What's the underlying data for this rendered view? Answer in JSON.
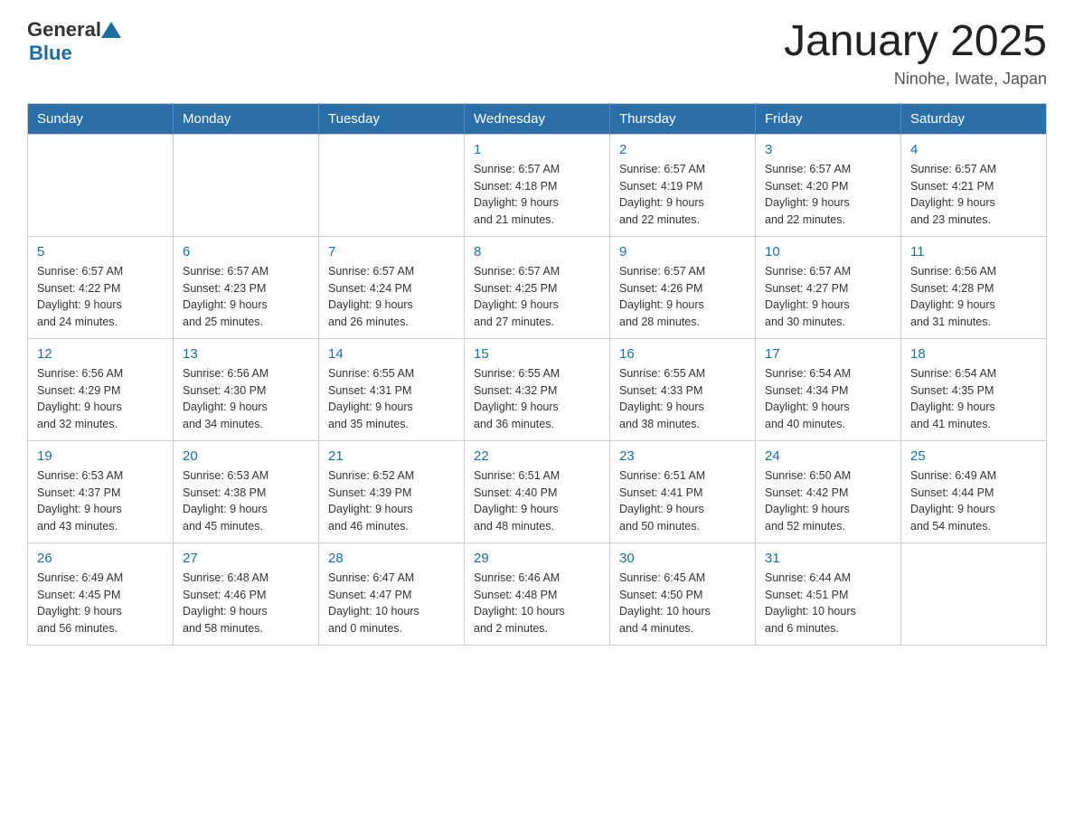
{
  "header": {
    "logo_general": "General",
    "logo_blue": "Blue",
    "title": "January 2025",
    "subtitle": "Ninohe, Iwate, Japan"
  },
  "weekdays": [
    "Sunday",
    "Monday",
    "Tuesday",
    "Wednesday",
    "Thursday",
    "Friday",
    "Saturday"
  ],
  "weeks": [
    [
      {
        "day": "",
        "info": ""
      },
      {
        "day": "",
        "info": ""
      },
      {
        "day": "",
        "info": ""
      },
      {
        "day": "1",
        "info": "Sunrise: 6:57 AM\nSunset: 4:18 PM\nDaylight: 9 hours\nand 21 minutes."
      },
      {
        "day": "2",
        "info": "Sunrise: 6:57 AM\nSunset: 4:19 PM\nDaylight: 9 hours\nand 22 minutes."
      },
      {
        "day": "3",
        "info": "Sunrise: 6:57 AM\nSunset: 4:20 PM\nDaylight: 9 hours\nand 22 minutes."
      },
      {
        "day": "4",
        "info": "Sunrise: 6:57 AM\nSunset: 4:21 PM\nDaylight: 9 hours\nand 23 minutes."
      }
    ],
    [
      {
        "day": "5",
        "info": "Sunrise: 6:57 AM\nSunset: 4:22 PM\nDaylight: 9 hours\nand 24 minutes."
      },
      {
        "day": "6",
        "info": "Sunrise: 6:57 AM\nSunset: 4:23 PM\nDaylight: 9 hours\nand 25 minutes."
      },
      {
        "day": "7",
        "info": "Sunrise: 6:57 AM\nSunset: 4:24 PM\nDaylight: 9 hours\nand 26 minutes."
      },
      {
        "day": "8",
        "info": "Sunrise: 6:57 AM\nSunset: 4:25 PM\nDaylight: 9 hours\nand 27 minutes."
      },
      {
        "day": "9",
        "info": "Sunrise: 6:57 AM\nSunset: 4:26 PM\nDaylight: 9 hours\nand 28 minutes."
      },
      {
        "day": "10",
        "info": "Sunrise: 6:57 AM\nSunset: 4:27 PM\nDaylight: 9 hours\nand 30 minutes."
      },
      {
        "day": "11",
        "info": "Sunrise: 6:56 AM\nSunset: 4:28 PM\nDaylight: 9 hours\nand 31 minutes."
      }
    ],
    [
      {
        "day": "12",
        "info": "Sunrise: 6:56 AM\nSunset: 4:29 PM\nDaylight: 9 hours\nand 32 minutes."
      },
      {
        "day": "13",
        "info": "Sunrise: 6:56 AM\nSunset: 4:30 PM\nDaylight: 9 hours\nand 34 minutes."
      },
      {
        "day": "14",
        "info": "Sunrise: 6:55 AM\nSunset: 4:31 PM\nDaylight: 9 hours\nand 35 minutes."
      },
      {
        "day": "15",
        "info": "Sunrise: 6:55 AM\nSunset: 4:32 PM\nDaylight: 9 hours\nand 36 minutes."
      },
      {
        "day": "16",
        "info": "Sunrise: 6:55 AM\nSunset: 4:33 PM\nDaylight: 9 hours\nand 38 minutes."
      },
      {
        "day": "17",
        "info": "Sunrise: 6:54 AM\nSunset: 4:34 PM\nDaylight: 9 hours\nand 40 minutes."
      },
      {
        "day": "18",
        "info": "Sunrise: 6:54 AM\nSunset: 4:35 PM\nDaylight: 9 hours\nand 41 minutes."
      }
    ],
    [
      {
        "day": "19",
        "info": "Sunrise: 6:53 AM\nSunset: 4:37 PM\nDaylight: 9 hours\nand 43 minutes."
      },
      {
        "day": "20",
        "info": "Sunrise: 6:53 AM\nSunset: 4:38 PM\nDaylight: 9 hours\nand 45 minutes."
      },
      {
        "day": "21",
        "info": "Sunrise: 6:52 AM\nSunset: 4:39 PM\nDaylight: 9 hours\nand 46 minutes."
      },
      {
        "day": "22",
        "info": "Sunrise: 6:51 AM\nSunset: 4:40 PM\nDaylight: 9 hours\nand 48 minutes."
      },
      {
        "day": "23",
        "info": "Sunrise: 6:51 AM\nSunset: 4:41 PM\nDaylight: 9 hours\nand 50 minutes."
      },
      {
        "day": "24",
        "info": "Sunrise: 6:50 AM\nSunset: 4:42 PM\nDaylight: 9 hours\nand 52 minutes."
      },
      {
        "day": "25",
        "info": "Sunrise: 6:49 AM\nSunset: 4:44 PM\nDaylight: 9 hours\nand 54 minutes."
      }
    ],
    [
      {
        "day": "26",
        "info": "Sunrise: 6:49 AM\nSunset: 4:45 PM\nDaylight: 9 hours\nand 56 minutes."
      },
      {
        "day": "27",
        "info": "Sunrise: 6:48 AM\nSunset: 4:46 PM\nDaylight: 9 hours\nand 58 minutes."
      },
      {
        "day": "28",
        "info": "Sunrise: 6:47 AM\nSunset: 4:47 PM\nDaylight: 10 hours\nand 0 minutes."
      },
      {
        "day": "29",
        "info": "Sunrise: 6:46 AM\nSunset: 4:48 PM\nDaylight: 10 hours\nand 2 minutes."
      },
      {
        "day": "30",
        "info": "Sunrise: 6:45 AM\nSunset: 4:50 PM\nDaylight: 10 hours\nand 4 minutes."
      },
      {
        "day": "31",
        "info": "Sunrise: 6:44 AM\nSunset: 4:51 PM\nDaylight: 10 hours\nand 6 minutes."
      },
      {
        "day": "",
        "info": ""
      }
    ]
  ]
}
